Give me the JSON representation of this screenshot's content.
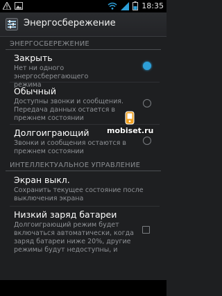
{
  "status_bar": {
    "time": "18:35",
    "icons": [
      "warning-icon",
      "photo-icon",
      "wifi-icon",
      "signal-icon",
      "battery-icon"
    ]
  },
  "action_bar": {
    "title": "Энергосбережение",
    "icon": "settings-icon"
  },
  "sections": {
    "energy_saving": "ЭНЕРГОСБЕРЕЖЕНИЕ",
    "smart_control": "ИНТЕЛЛЕКТУАЛЬНОЕ УПРАВЛЕНИЕ"
  },
  "modes": [
    {
      "title": "Закрыть",
      "line1": "Нет ни одного энергосберегающего",
      "line2": "режима",
      "line3": "",
      "selected": true
    },
    {
      "title": "Обычный",
      "line1": "Доступны звонки и сообщения.",
      "line2": "Передача данных остается в",
      "line3": "прежнем состоянии",
      "selected": false
    },
    {
      "title": "Долгоиграющий",
      "line1": "Звонки и сообщения остаются в",
      "line2": "прежнем состоянии",
      "line3": "",
      "selected": false
    }
  ],
  "smart": [
    {
      "title": "Экран выкл.",
      "line1": "Сохранить текущее состояние после",
      "line2": "выключения экрана"
    },
    {
      "title": "Низкий заряд батареи",
      "line1": "Долгоиграющий режим будет",
      "line2": "включаться автоматически, когда",
      "line3": "заряд батареи ниже 20%, другие",
      "line4": "режимы будут недоступны, и",
      "checked": false
    }
  ],
  "watermark": {
    "text": "mobiset.ru",
    "icon": "phone-logo-icon"
  },
  "colors": {
    "accent": "#2d9fd8",
    "background": "#1e1f21"
  }
}
